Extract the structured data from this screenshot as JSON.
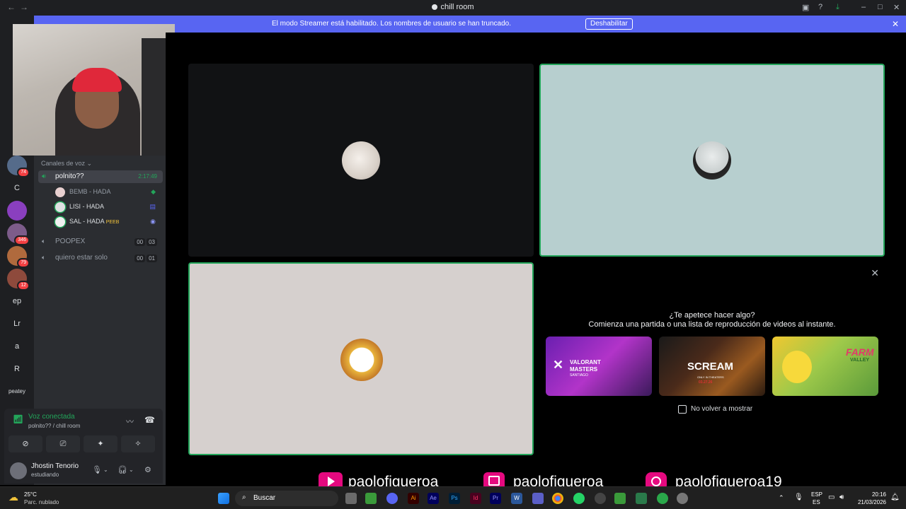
{
  "window": {
    "title": "chill room"
  },
  "banner": {
    "message": "El modo Streamer está habilitado. Los nombres de usuario se han truncado.",
    "button": "Deshabilitar"
  },
  "rail": {
    "letters": [
      "C",
      "ep",
      "Lr",
      "a",
      "R",
      "peatey"
    ],
    "badges": [
      "74",
      "346",
      "79",
      "12"
    ]
  },
  "sidebar": {
    "section": "Canales de voz",
    "channels": [
      {
        "name": "polnito??",
        "time": "2:17:49"
      },
      {
        "name": "POOPEX",
        "counts": [
          "00",
          "03"
        ]
      },
      {
        "name": "quiero estar solo",
        "counts": [
          "00",
          "01"
        ]
      }
    ],
    "users": [
      {
        "name": "BEMB - HADA"
      },
      {
        "name": "LISI - HADA"
      },
      {
        "name": "SAL - HADA",
        "tag": "PEEB"
      }
    ]
  },
  "voice": {
    "status": "Voz conectada",
    "channel": "polnito?? / chill room"
  },
  "user": {
    "name": "Jhostin Tenorio",
    "status": "estudiando"
  },
  "activity": {
    "heading": "¿Te apetece hacer algo?",
    "subheading": "Comienza una partida o una lista de reproducción de videos al instante.",
    "games": [
      {
        "line1": "VALORANT",
        "line2": "MASTERS",
        "line3": "SANTIAGO"
      },
      {
        "line1": "SCREAM",
        "line2": "ONLY IN THEATERS",
        "line3": "03.27.26"
      },
      {
        "line1": "FARM",
        "line2": "VALLEY"
      }
    ],
    "checkbox": "No volver a mostrar"
  },
  "social": [
    {
      "network": "youtube",
      "handle": "paolofigueroa",
      "color": "#e5097f"
    },
    {
      "network": "twitch",
      "handle": "paolofigueroa",
      "color": "#e5097f"
    },
    {
      "network": "instagram",
      "handle": "paolofigueroa19",
      "color": "#e5097f"
    }
  ],
  "taskbar": {
    "weather_temp": "25°C",
    "weather_desc": "Parc. nublado",
    "search": "Buscar",
    "lang1": "ESP",
    "lang2": "ES",
    "time": "20:16",
    "date": "21/03/2026"
  },
  "colors": {
    "accent": "#5865f2",
    "speaking": "#23a55a",
    "tile_mint": "#b7cfcf",
    "tile_beige": "#d6d0ce"
  }
}
